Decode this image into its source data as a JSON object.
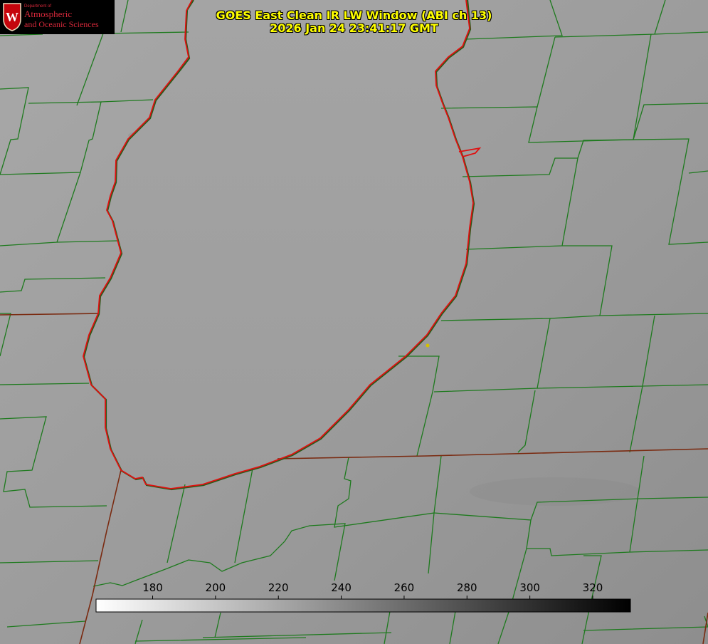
{
  "logo": {
    "department": "Department of",
    "line1": "Atmospheric",
    "line2": "and Oceanic Sciences",
    "crest_letter": "W"
  },
  "title": {
    "line1": "GOES East Clean IR LW Window (ABI ch 13)",
    "line2": "2026 Jan 24 23:41:17 GMT"
  },
  "colorbar": {
    "ticks": [
      "180",
      "200",
      "220",
      "240",
      "260",
      "280",
      "300",
      "320"
    ],
    "tick_values": [
      180,
      200,
      220,
      240,
      260,
      280,
      300,
      320
    ],
    "range": [
      162,
      332
    ],
    "gradient": "white-to-black"
  },
  "colors": {
    "county_lines": "#1e7a1e",
    "state_lines": "#8b3a1a",
    "lake_outline": "#e01010",
    "title_text": "#ffff00",
    "station_marker": "#d4c000"
  }
}
